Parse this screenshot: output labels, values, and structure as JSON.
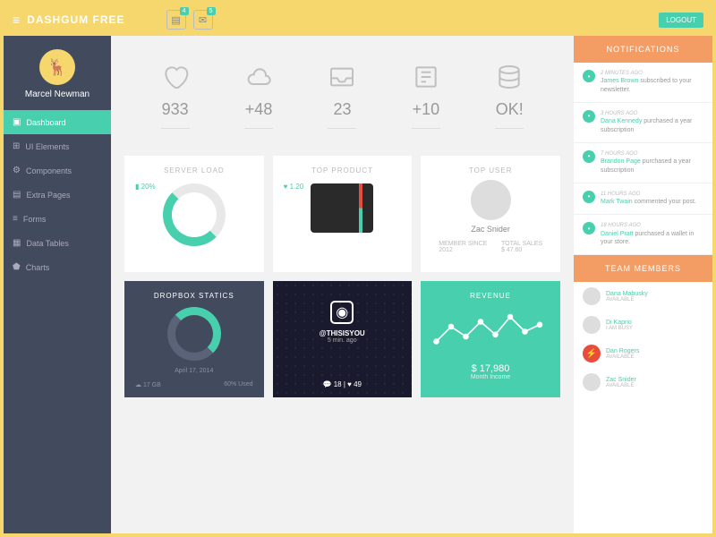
{
  "header": {
    "brand": "DASHGUM FREE",
    "inbox_badge": "4",
    "mail_badge": "5",
    "logout": "LOGOUT"
  },
  "sidebar": {
    "username": "Marcel Newman",
    "items": [
      {
        "icon": "▣",
        "label": "Dashboard",
        "active": true
      },
      {
        "icon": "⊞",
        "label": "UI Elements"
      },
      {
        "icon": "⚙",
        "label": "Components"
      },
      {
        "icon": "▤",
        "label": "Extra Pages"
      },
      {
        "icon": "≡",
        "label": "Forms"
      },
      {
        "icon": "▦",
        "label": "Data Tables"
      },
      {
        "icon": "⬟",
        "label": "Charts"
      }
    ]
  },
  "stats": [
    {
      "icon": "heart",
      "value": "933"
    },
    {
      "icon": "cloud",
      "value": "+48"
    },
    {
      "icon": "inbox",
      "value": "23"
    },
    {
      "icon": "news",
      "value": "+10"
    },
    {
      "icon": "db",
      "value": "OK!"
    }
  ],
  "cards": {
    "server": {
      "title": "SERVER LOAD",
      "pct": "20%"
    },
    "product": {
      "title": "TOP PRODUCT",
      "likes": "1.20"
    },
    "user": {
      "title": "TOP USER",
      "name": "Zac Snider",
      "since_label": "MEMBER SINCE",
      "since": "2012",
      "sales_label": "TOTAL SALES",
      "sales": "$ 47.60"
    }
  },
  "dark": {
    "dropbox": {
      "title": "DROPBOX STATICS",
      "date": "April 17, 2014",
      "size": "17 GB",
      "used": "60% Used"
    },
    "insta": {
      "handle": "@THISISYOU",
      "time": "5 min. ago",
      "comments": "18",
      "likes": "49"
    },
    "revenue": {
      "title": "REVENUE",
      "amount": "$ 17,980",
      "label": "Month Income"
    }
  },
  "notifications": {
    "title": "NOTIFICATIONS",
    "items": [
      {
        "time": "2 MINUTES AGO",
        "actor": "James Brown",
        "text": " subscribed to your newsletter."
      },
      {
        "time": "3 HOURS AGO",
        "actor": "Dana Kennedy",
        "text": " purchased a year subscription"
      },
      {
        "time": "7 HOURS AGO",
        "actor": "Brandon Page",
        "text": " purchased a year subscription"
      },
      {
        "time": "11 HOURS AGO",
        "actor": "Mark Twain",
        "text": " commented your post."
      },
      {
        "time": "18 HOURS AGO",
        "actor": "Daniel Pratt",
        "text": " purchased a wallet in your store."
      }
    ]
  },
  "team": {
    "title": "TEAM MEMBERS",
    "items": [
      {
        "name": "Dana Mabusky",
        "status": "AVAILABLE"
      },
      {
        "name": "Di Kaprio",
        "status": "I AM BUSY"
      },
      {
        "name": "Dan Rogers",
        "status": "AVAILABLE",
        "red": true
      },
      {
        "name": "Zac Snider",
        "status": "AVAILABLE"
      }
    ]
  }
}
